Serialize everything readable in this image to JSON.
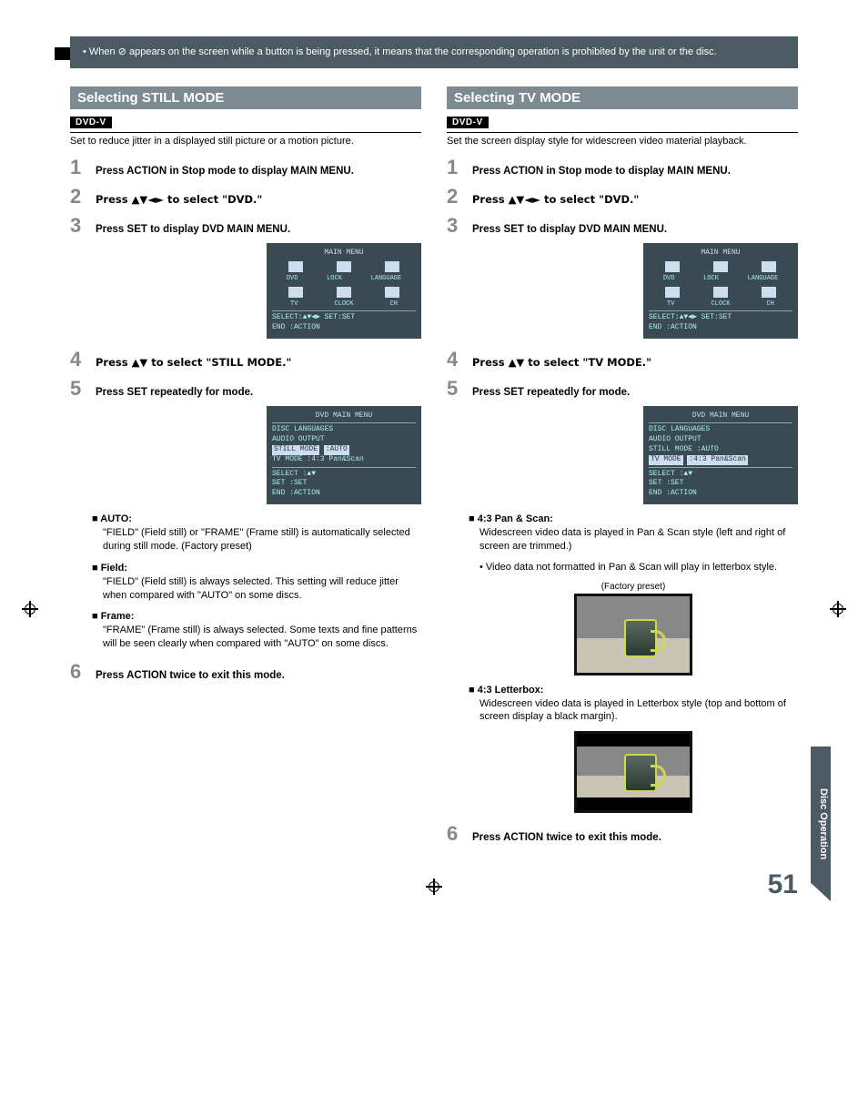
{
  "note": "• When ⊘ appears on the screen while a button is being pressed, it means that the corresponding operation is prohibited by the unit or the disc.",
  "sidetab": "Disc Operation",
  "pagenum": "51",
  "left": {
    "heading": "Selecting STILL MODE",
    "badge": "DVD-V",
    "intro": "Set to reduce jitter in a displayed still picture or a motion picture.",
    "steps": {
      "s1": "Press ACTION in Stop mode to display MAIN MENU.",
      "s2": "Press ▲▼◄► to select \"DVD.\"",
      "s3": "Press SET to display DVD MAIN MENU.",
      "s4": "Press ▲▼ to select \"STILL MODE.\"",
      "s5": "Press SET repeatedly for mode.",
      "s6": "Press ACTION twice to exit this mode."
    },
    "osd1": {
      "title": "MAIN MENU",
      "row1": {
        "a": "DVD",
        "b": "LOCK",
        "c": "LANGUAGE"
      },
      "row2": {
        "a": "TV",
        "b": "CLOCK",
        "c": "CH"
      },
      "foot1": "SELECT:▲▼◄►  SET:SET",
      "foot2": "END   :ACTION"
    },
    "osd2": {
      "title": "DVD MAIN MENU",
      "l1": "DISC LANGUAGES",
      "l2": "AUDIO OUTPUT",
      "l3a": "STILL MODE",
      "l3b": ":AUTO",
      "l4a": "TV MODE",
      "l4b": ":4:3 Pan&Scan",
      "f1": "SELECT  :▲▼",
      "f2": "SET     :SET",
      "f3": "END     :ACTION"
    },
    "modes": {
      "auto_h": "AUTO:",
      "auto_p": "\"FIELD\" (Field still) or \"FRAME\" (Frame still) is automatically selected during still mode. (Factory preset)",
      "field_h": "Field:",
      "field_p": "\"FIELD\" (Field still) is always selected. This setting will reduce jitter when compared with \"AUTO\" on some discs.",
      "frame_h": "Frame:",
      "frame_p": "\"FRAME\" (Frame still) is always selected. Some texts and fine patterns will be seen clearly when compared with \"AUTO\" on some discs."
    }
  },
  "right": {
    "heading": "Selecting TV MODE",
    "badge": "DVD-V",
    "intro": "Set the screen display style for widescreen video material playback.",
    "steps": {
      "s1": "Press ACTION in Stop mode to display MAIN MENU.",
      "s2": "Press ▲▼◄► to select \"DVD.\"",
      "s3": "Press SET to display DVD MAIN MENU.",
      "s4": "Press ▲▼ to select \"TV MODE.\"",
      "s5": "Press SET repeatedly for mode.",
      "s6": "Press ACTION twice to exit this mode."
    },
    "osd1": {
      "title": "MAIN MENU",
      "row1": {
        "a": "DVD",
        "b": "LOCK",
        "c": "LANGUAGE"
      },
      "row2": {
        "a": "TV",
        "b": "CLOCK",
        "c": "CH"
      },
      "foot1": "SELECT:▲▼◄►  SET:SET",
      "foot2": "END   :ACTION"
    },
    "osd2": {
      "title": "DVD MAIN MENU",
      "l1": "DISC LANGUAGES",
      "l2": "AUDIO OUTPUT",
      "l3a": "STILL MODE",
      "l3b": ":AUTO",
      "l4a": "TV MODE",
      "l4b": ":4:3 Pan&Scan",
      "f1": "SELECT  :▲▼",
      "f2": "SET     :SET",
      "f3": "END     :ACTION"
    },
    "modes": {
      "pan_h": "4:3 Pan & Scan:",
      "pan_p1": "Widescreen video data is played in Pan & Scan style (left and right of screen are trimmed.)",
      "pan_p2": "• Video data not formatted in Pan & Scan will play in letterbox style.",
      "factory": "(Factory preset)",
      "lb_h": "4:3 Letterbox:",
      "lb_p": "Widescreen video data is played in Letterbox style (top and bottom of screen display a  black margin)."
    }
  }
}
